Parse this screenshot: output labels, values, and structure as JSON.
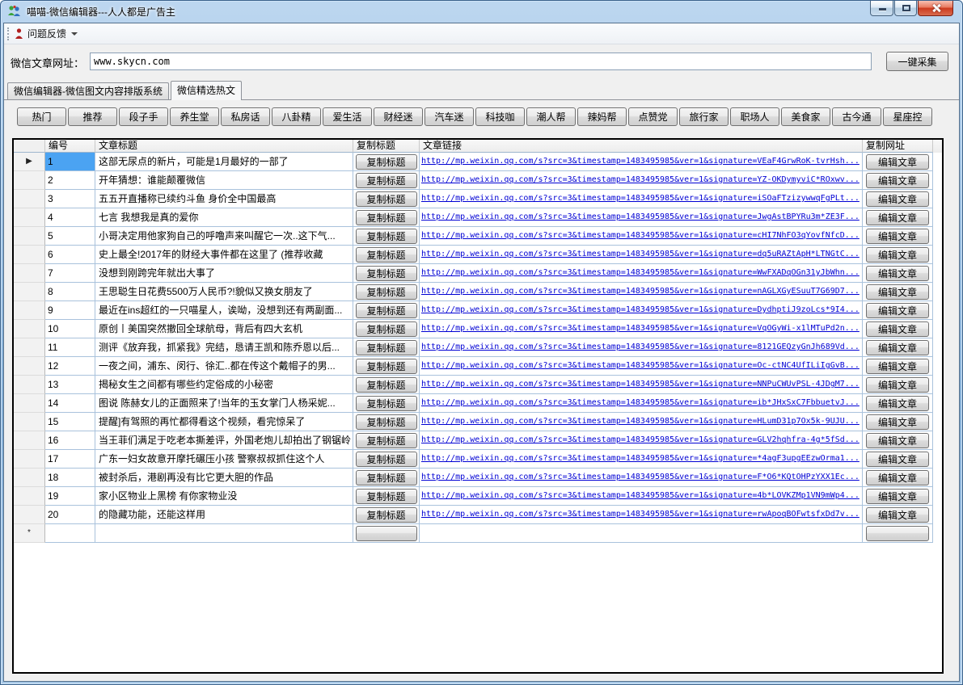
{
  "window": {
    "title": "喵喵-微信编辑器---人人都是广告主",
    "controls": {
      "minimize": "minimize",
      "maximize": "maximize",
      "close": "close"
    }
  },
  "icons": {
    "app_icon": "people-figures",
    "feedback_icon": "red-person",
    "dropdown_icon": "caret-down",
    "row_selected_icon": "right-arrow"
  },
  "toolbar": {
    "feedback_label": "问题反馈"
  },
  "url_bar": {
    "label": "微信文章网址：",
    "value": "www.skycn.com",
    "collect_button": "一键采集"
  },
  "tabs": [
    {
      "label": "微信编辑器-微信图文内容排版系统",
      "active": false
    },
    {
      "label": "微信精选热文",
      "active": true
    }
  ],
  "categories": [
    "热门",
    "推荐",
    "段子手",
    "养生堂",
    "私房话",
    "八卦精",
    "爱生活",
    "财经迷",
    "汽车迷",
    "科技咖",
    "潮人帮",
    "辣妈帮",
    "点赞党",
    "旅行家",
    "职场人",
    "美食家",
    "古今通",
    "星座控"
  ],
  "grid": {
    "headers": {
      "index": "编号",
      "title": "文章标题",
      "copy_title": "复制标题",
      "link": "文章链接",
      "copy_url": "复制网址"
    },
    "copy_title_button": "复制标题",
    "edit_button": "编辑文章",
    "selected_index": 1,
    "selected_row_arrow": "▶",
    "new_row_marker": "*",
    "rows": [
      {
        "index": 1,
        "title": "这部无尿点的新片，可能是1月最好的一部了",
        "url": "http://mp.weixin.qq.com/s?src=3&timestamp=1483495985&ver=1&signature=VEaF4GrwRoK-tvrHsh..."
      },
      {
        "index": 2,
        "title": "开年猜想：谁能颠覆微信",
        "url": "http://mp.weixin.qq.com/s?src=3&timestamp=1483495985&ver=1&signature=YZ-OKDymyviC*ROxwv..."
      },
      {
        "index": 3,
        "title": "五五开直播称已续约斗鱼 身价全中国最高",
        "url": "http://mp.weixin.qq.com/s?src=3&timestamp=1483495985&ver=1&signature=iSOaFTzizywwqFgPLt..."
      },
      {
        "index": 4,
        "title": "七言 我想我是真的爱你",
        "url": "http://mp.weixin.qq.com/s?src=3&timestamp=1483495985&ver=1&signature=JwgAstBPYRu3m*ZE3F..."
      },
      {
        "index": 5,
        "title": "小哥决定用他家狗自己的呼噜声来叫醒它一次..这下气...",
        "url": "http://mp.weixin.qq.com/s?src=3&timestamp=1483495985&ver=1&signature=cHI7NhFO3qYovfNfcD..."
      },
      {
        "index": 6,
        "title": "史上最全!2017年的财经大事件都在这里了 (推荐收藏",
        "url": "http://mp.weixin.qq.com/s?src=3&timestamp=1483495985&ver=1&signature=dq5uRAZtApH*LTNGtC..."
      },
      {
        "index": 7,
        "title": "没想到刚跨完年就出大事了",
        "url": "http://mp.weixin.qq.com/s?src=3&timestamp=1483495985&ver=1&signature=WwFXADqOGn31yJbWhn..."
      },
      {
        "index": 8,
        "title": "王思聪生日花费5500万人民币?!貌似又换女朋友了",
        "url": "http://mp.weixin.qq.com/s?src=3&timestamp=1483495985&ver=1&signature=nAGLXGyESuuT7G69D7..."
      },
      {
        "index": 9,
        "title": "最近在ins超红的一只喵星人，诶呦，没想到还有两副面...",
        "url": "http://mp.weixin.qq.com/s?src=3&timestamp=1483495985&ver=1&signature=DydhptiJ9zoLcs*9I4..."
      },
      {
        "index": 10,
        "title": "原创丨美国突然撤回全球航母，背后有四大玄机",
        "url": "http://mp.weixin.qq.com/s?src=3&timestamp=1483495985&ver=1&signature=VqOGyWi-x1lMTuPd2n..."
      },
      {
        "index": 11,
        "title": "测评《放弃我，抓紧我》完结，恳请王凯和陈乔恩以后...",
        "url": "http://mp.weixin.qq.com/s?src=3&timestamp=1483495985&ver=1&signature=8121GEQzyGnJh689Vd..."
      },
      {
        "index": 12,
        "title": "一夜之间，浦东、闵行、徐汇..都在传这个戴帽子的男...",
        "url": "http://mp.weixin.qq.com/s?src=3&timestamp=1483495985&ver=1&signature=Oc-ctNC4UfILiIgGvB..."
      },
      {
        "index": 13,
        "title": "揭秘女生之间都有哪些约定俗成的小秘密",
        "url": "http://mp.weixin.qq.com/s?src=3&timestamp=1483495985&ver=1&signature=NNPuCWUvPSL-4JDgM7..."
      },
      {
        "index": 14,
        "title": "图说 陈赫女儿的正面照来了!当年的玉女掌门人杨采妮...",
        "url": "http://mp.weixin.qq.com/s?src=3&timestamp=1483495985&ver=1&signature=ib*JHxSxC7FbbuetvJ..."
      },
      {
        "index": 15,
        "title": "提醒]有驾照的再忙都得看这个视频，看完惊呆了",
        "url": "http://mp.weixin.qq.com/s?src=3&timestamp=1483495985&ver=1&signature=HLumD31p7Ox5k-9UJU..."
      },
      {
        "index": 16,
        "title": "当王菲们满足于吃老本撕差评，外国老炮儿却拍出了钢锯岭",
        "url": "http://mp.weixin.qq.com/s?src=3&timestamp=1483495985&ver=1&signature=GLV2hqhfra-4g*5fSd..."
      },
      {
        "index": 17,
        "title": "广东一妇女故意开摩托碾压小孩 警察叔叔抓住这个人",
        "url": "http://mp.weixin.qq.com/s?src=3&timestamp=1483495985&ver=1&signature=*4agF3upgEEzwOrma1..."
      },
      {
        "index": 18,
        "title": "被封杀后，港剧再没有比它更大胆的作品",
        "url": "http://mp.weixin.qq.com/s?src=3&timestamp=1483495985&ver=1&signature=F*O6*KQtOHPzYXX1Ec..."
      },
      {
        "index": 19,
        "title": "家小区物业上黑榜 有你家物业没",
        "url": "http://mp.weixin.qq.com/s?src=3&timestamp=1483495985&ver=1&signature=4b*LOVKZMp1VN9mWp4..."
      },
      {
        "index": 20,
        "title": "的隐藏功能，还能这样用",
        "url": "http://mp.weixin.qq.com/s?src=3&timestamp=1483495985&ver=1&signature=rwApoqBOFwtsfxDd7v..."
      }
    ]
  },
  "colors": {
    "selection_blue": "#4ba3f2",
    "link_blue": "#0000d4",
    "close_red": "#cc3a1e",
    "gridline_blue": "#a9c2dc",
    "titlebar_blue": "#9cc0e2"
  }
}
